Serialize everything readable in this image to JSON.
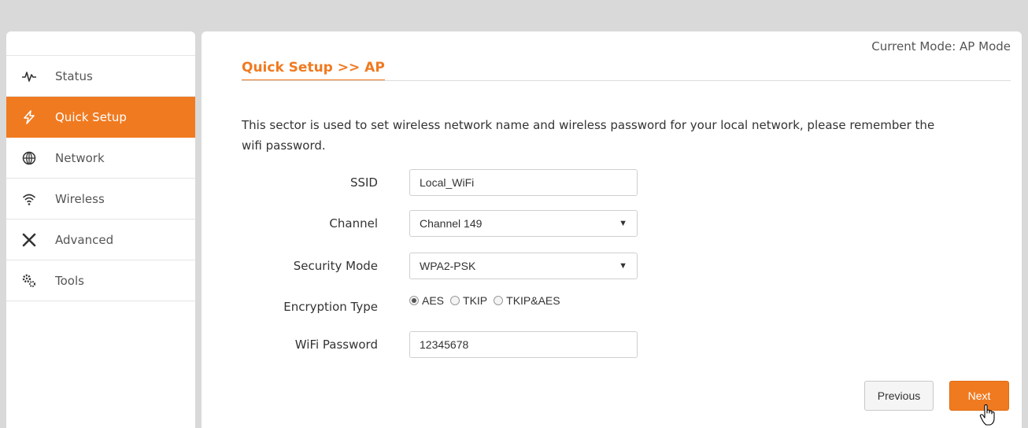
{
  "sidebar": {
    "items": [
      {
        "label": "Status",
        "icon": "pulse-icon"
      },
      {
        "label": "Quick Setup",
        "icon": "lightning-icon",
        "active": true
      },
      {
        "label": "Network",
        "icon": "globe-icon"
      },
      {
        "label": "Wireless",
        "icon": "wifi-icon"
      },
      {
        "label": "Advanced",
        "icon": "tools-cross-icon"
      },
      {
        "label": "Tools",
        "icon": "gears-icon"
      }
    ]
  },
  "header": {
    "mode": "Current Mode: AP Mode",
    "title": "Quick Setup >>  AP"
  },
  "description": "This sector is used to set wireless network name and wireless password for your local network, please remember the wifi password.",
  "form": {
    "ssid": {
      "label": "SSID",
      "value": "Local_WiFi"
    },
    "channel": {
      "label": "Channel",
      "value": "Channel 149"
    },
    "security": {
      "label": "Security Mode",
      "value": "WPA2-PSK"
    },
    "encryption": {
      "label": "Encryption Type",
      "options": [
        "AES",
        "TKIP",
        "TKIP&AES"
      ],
      "selected": "AES"
    },
    "password": {
      "label": "WiFi Password",
      "value": "12345678"
    }
  },
  "buttons": {
    "previous": "Previous",
    "next": "Next"
  },
  "colors": {
    "accent": "#f07a20",
    "background": "#d9d9d9"
  }
}
